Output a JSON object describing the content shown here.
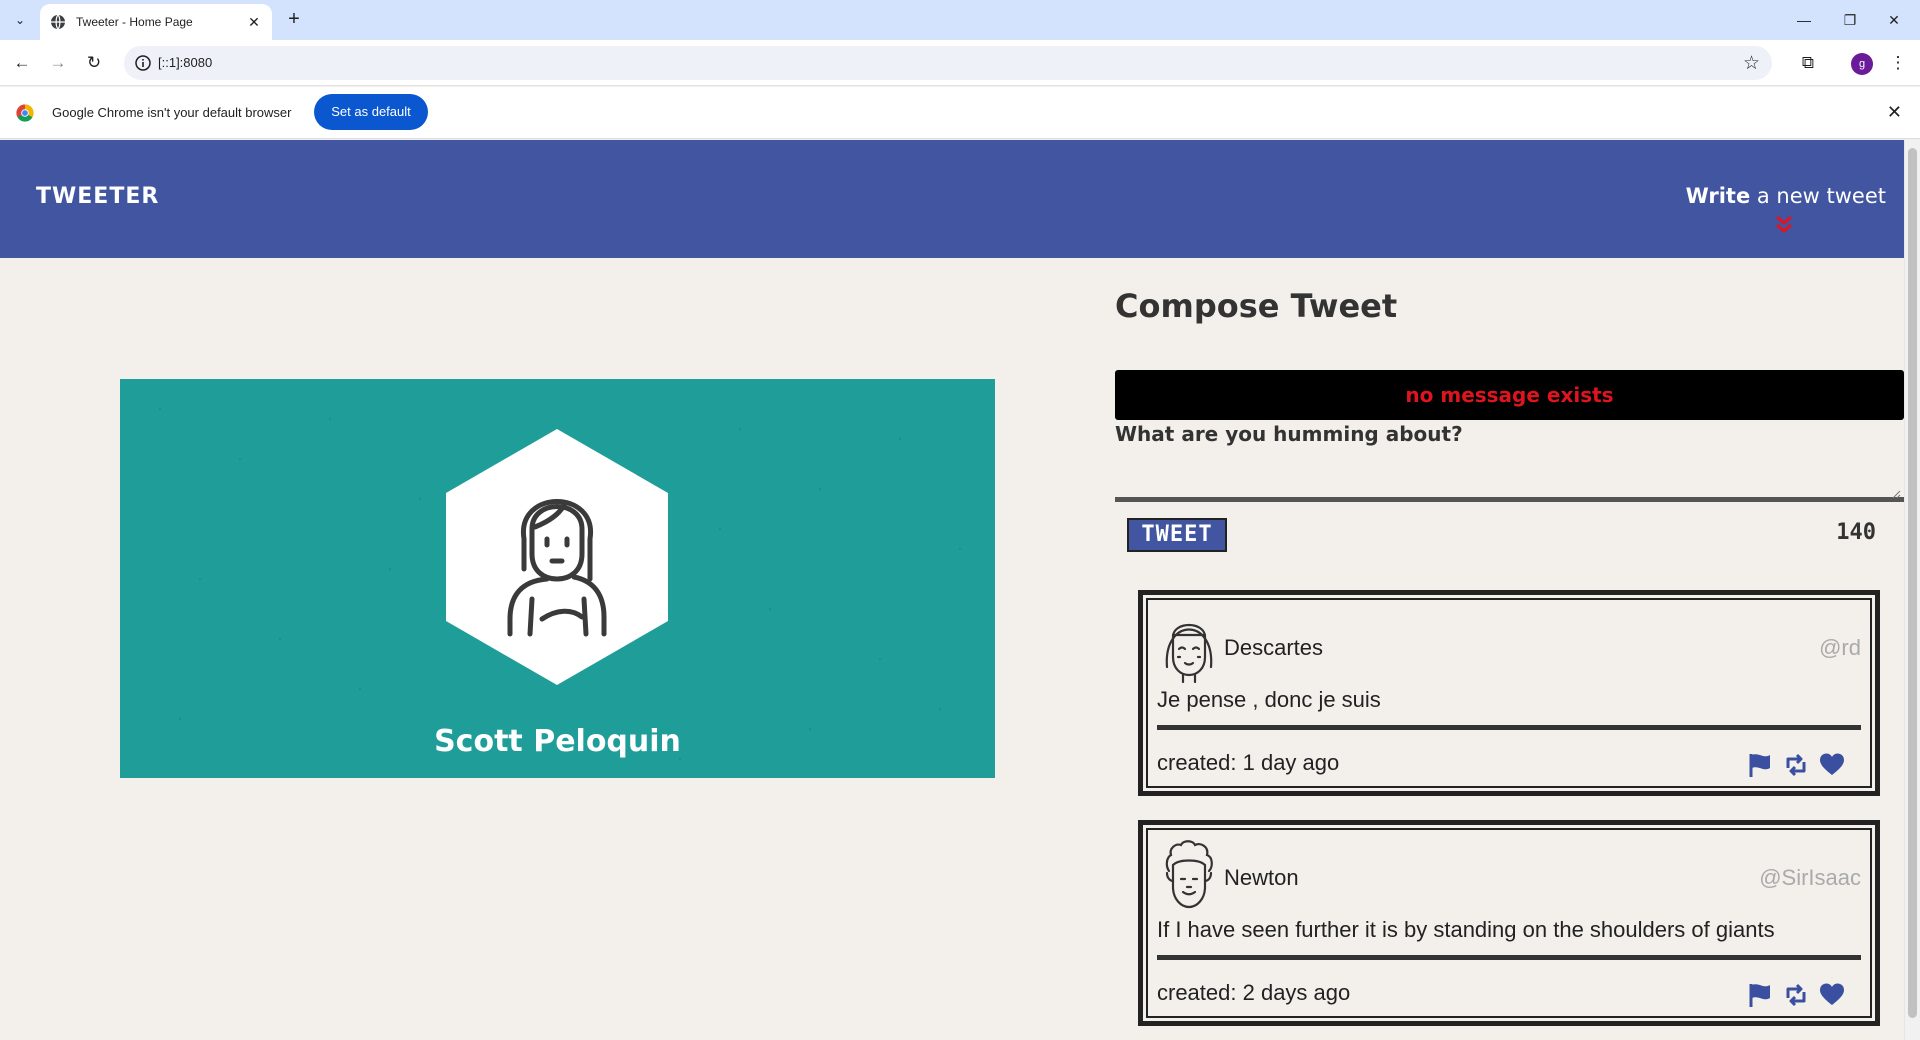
{
  "browser": {
    "tab_title": "Tweeter - Home Page",
    "url": "[::1]:8080",
    "profile_initial": "g",
    "infobar_text": "Google Chrome isn't your default browser",
    "set_default_label": "Set as default"
  },
  "navbar": {
    "brand": "TWEETER",
    "write_bold": "Write",
    "write_rest": " a new tweet",
    "accent": "#4155a0",
    "arrow_color": "#e0141e"
  },
  "profile": {
    "name": "Scott Peloquin",
    "card_color": "#1f9d99"
  },
  "compose": {
    "title": "Compose Tweet",
    "error": "no message exists",
    "label": "What are you humming about?",
    "textarea_value": "",
    "button_label": "TWEET",
    "counter": "140"
  },
  "tweets": [
    {
      "name": "Descartes",
      "handle": "@rd",
      "content": "Je pense , donc je suis",
      "created": "created: 1 day ago",
      "avatar_icon": "girl-avatar-icon"
    },
    {
      "name": "Newton",
      "handle": "@SirIsaac",
      "content": "If I have seen further it is by standing on the shoulders of giants",
      "created": "created: 2 days ago",
      "avatar_icon": "curly-hair-avatar-icon"
    }
  ]
}
